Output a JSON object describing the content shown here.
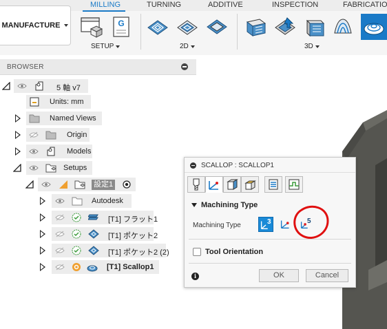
{
  "toolbar": {
    "workspace_label": "MANUFACTURE",
    "tabs": [
      "MILLING",
      "TURNING",
      "ADDITIVE",
      "INSPECTION",
      "FABRICATION"
    ],
    "groups": {
      "setup": "SETUP",
      "two_d": "2D",
      "three_d": "3D"
    }
  },
  "browser": {
    "title": "BROWSER",
    "root": "5 軸 v7",
    "units": "Units: mm",
    "named_views": "Named Views",
    "origin": "Origin",
    "models": "Models",
    "setups": "Setups",
    "setup1": "設定1",
    "autodesk": "Autodesk",
    "op1": "[T1] フラット1",
    "op2": "[T1] ポケット2",
    "op3": "[T1] ポケット2 (2)",
    "op4": "[T1] Scallop1"
  },
  "dialog": {
    "title": "SCALLOP : SCALLOP1",
    "section": "Machining Type",
    "field_label": "Machining Type",
    "option_3axis": "3",
    "option_5axis": "5",
    "tool_orientation": "Tool Orientation",
    "ok": "OK",
    "cancel": "Cancel"
  },
  "colors": {
    "accent": "#1a7ac7",
    "annotation": "#e01010"
  }
}
